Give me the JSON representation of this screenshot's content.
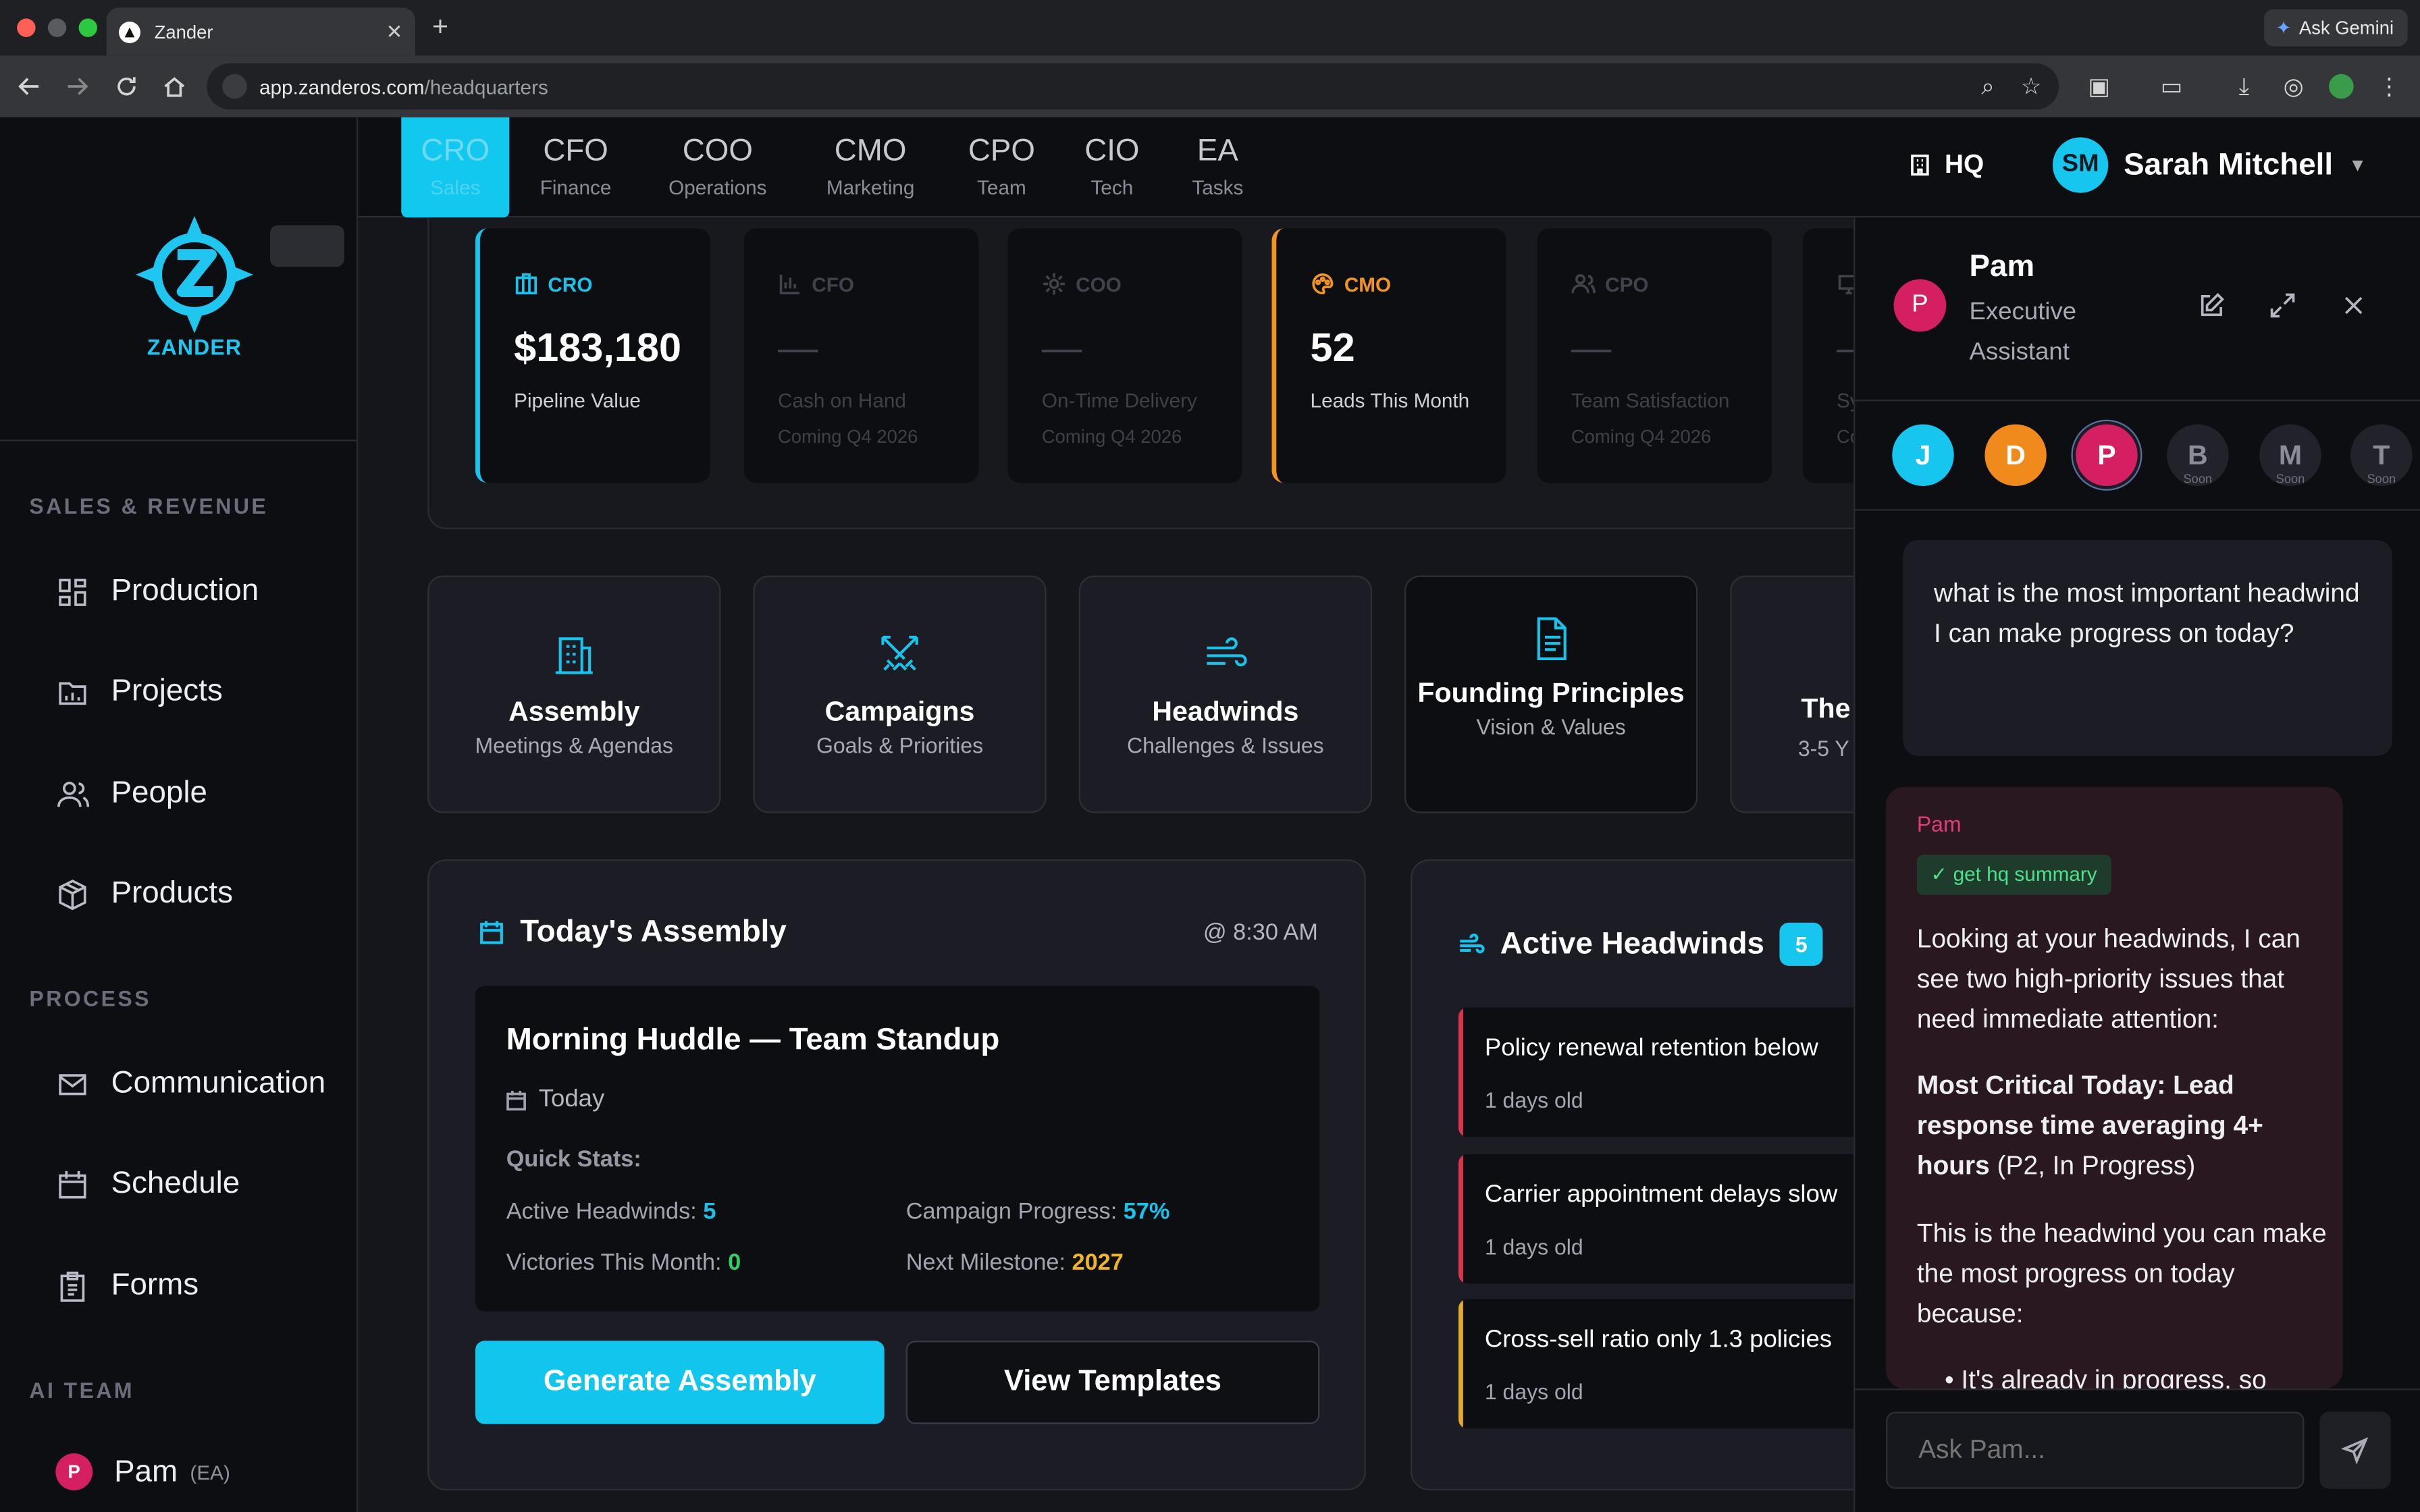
{
  "browser": {
    "tab_title": "Zander",
    "url_host": "app.zanderos.com",
    "url_path": "/headquarters",
    "gemini_label": "Ask Gemini"
  },
  "logo": {
    "word": "ZANDER",
    "color": "#1fc6ef"
  },
  "sidebar": {
    "sections": [
      {
        "title": "SALES & REVENUE",
        "items": [
          {
            "label": "Production",
            "icon": "grid-icon"
          },
          {
            "label": "Projects",
            "icon": "folder-icon"
          },
          {
            "label": "People",
            "icon": "people-icon"
          },
          {
            "label": "Products",
            "icon": "box-icon"
          }
        ]
      },
      {
        "title": "PROCESS",
        "items": [
          {
            "label": "Communication",
            "icon": "mail-icon"
          },
          {
            "label": "Schedule",
            "icon": "calendar-icon"
          },
          {
            "label": "Forms",
            "icon": "clipboard-icon"
          }
        ]
      },
      {
        "title": "AI TEAM",
        "items": [
          {
            "label": "Pam",
            "initial": "P",
            "role": "(EA)"
          }
        ]
      }
    ]
  },
  "topnav": {
    "tabs": [
      {
        "abbr": "CRO",
        "sub": "Sales",
        "active": true
      },
      {
        "abbr": "CFO",
        "sub": "Finance"
      },
      {
        "abbr": "COO",
        "sub": "Operations"
      },
      {
        "abbr": "CMO",
        "sub": "Marketing"
      },
      {
        "abbr": "CPO",
        "sub": "Team"
      },
      {
        "abbr": "CIO",
        "sub": "Tech"
      },
      {
        "abbr": "EA",
        "sub": "Tasks"
      }
    ],
    "hq_label": "HQ",
    "user": {
      "initials": "SM",
      "name": "Sarah Mitchell"
    }
  },
  "metrics": [
    {
      "label": "CRO",
      "value": "$183,180",
      "desc": "Pipeline Value",
      "soon": "",
      "color": "#19c3ec"
    },
    {
      "label": "CFO",
      "value": "—",
      "desc": "Cash on Hand",
      "soon": "Coming Q4 2026"
    },
    {
      "label": "COO",
      "value": "—",
      "desc": "On-Time Delivery",
      "soon": "Coming Q4 2026"
    },
    {
      "label": "CMO",
      "value": "52",
      "desc": "Leads This Month",
      "soon": "",
      "color": "#f39322"
    },
    {
      "label": "CPO",
      "value": "—",
      "desc": "Team Satisfaction",
      "soon": "Coming Q4 2026"
    },
    {
      "label": "",
      "value": "—",
      "desc": "Sy",
      "soon": "Co"
    }
  ],
  "quick_cards": [
    {
      "title": "Assembly",
      "sub": "Meetings & Agendas"
    },
    {
      "title": "Campaigns",
      "sub": "Goals & Priorities"
    },
    {
      "title": "Headwinds",
      "sub": "Challenges & Issues"
    },
    {
      "title": "Founding Principles",
      "sub": "Vision & Values"
    },
    {
      "title": "The",
      "sub": "3-5 Y"
    }
  ],
  "assembly": {
    "title": "Today's Assembly",
    "time": "@ 8:30 AM",
    "meeting_title": "Morning Huddle — Team Standup",
    "meeting_day": "Today",
    "quick_stats_label": "Quick Stats:",
    "stats": [
      {
        "label": "Active Headwinds:",
        "value": "5",
        "color": "#19c3ec"
      },
      {
        "label": "Campaign Progress:",
        "value": "57%",
        "color": "#19c3ec"
      },
      {
        "label": "Victories This Month:",
        "value": "0",
        "color": "#2fcf6a"
      },
      {
        "label": "Next Milestone:",
        "value": "2027",
        "color": "#f0b429"
      }
    ],
    "generate_label": "Generate Assembly",
    "templates_label": "View Templates"
  },
  "headwinds": {
    "title": "Active Headwinds",
    "count": "5",
    "items": [
      {
        "text": "Policy renewal retention below",
        "age": "1 days old",
        "color": "#e0344c"
      },
      {
        "text": "Carrier appointment delays slow",
        "age": "1 days old",
        "color": "#e0344c"
      },
      {
        "text": "Cross-sell ratio only 1.3 policies",
        "age": "1 days old",
        "color": "#e3a92a"
      }
    ]
  },
  "chat": {
    "name": "Pam",
    "role": "Executive Assistant",
    "initial": "P",
    "assistants": [
      {
        "initial": "J",
        "color": "#16c6ee",
        "soon": ""
      },
      {
        "initial": "D",
        "color": "#f08a1c",
        "soon": ""
      },
      {
        "initial": "P",
        "color": "#d51f63",
        "soon": ""
      },
      {
        "initial": "B",
        "color": "#2b2c33",
        "soon": "Soon"
      },
      {
        "initial": "M",
        "color": "#2b2c33",
        "soon": "Soon"
      },
      {
        "initial": "T",
        "color": "#2b2c33",
        "soon": "Soon"
      }
    ],
    "user_message": "what is the most important headwind I can make progress on today?",
    "ai_sender": "Pam",
    "tool_label": "✓ get hq summary",
    "ai_p1": "Looking at your headwinds, I can see two high-priority issues that need immediate attention:",
    "ai_p2_bold": "Most Critical Today: Lead response time averaging 4+ hours",
    "ai_p2_rest": " (P2, In Progress)",
    "ai_p3": "This is the headwind you can make the most progress on today because:",
    "ai_bullet": "It's already in progress, so",
    "input_placeholder": "Ask Pam..."
  }
}
